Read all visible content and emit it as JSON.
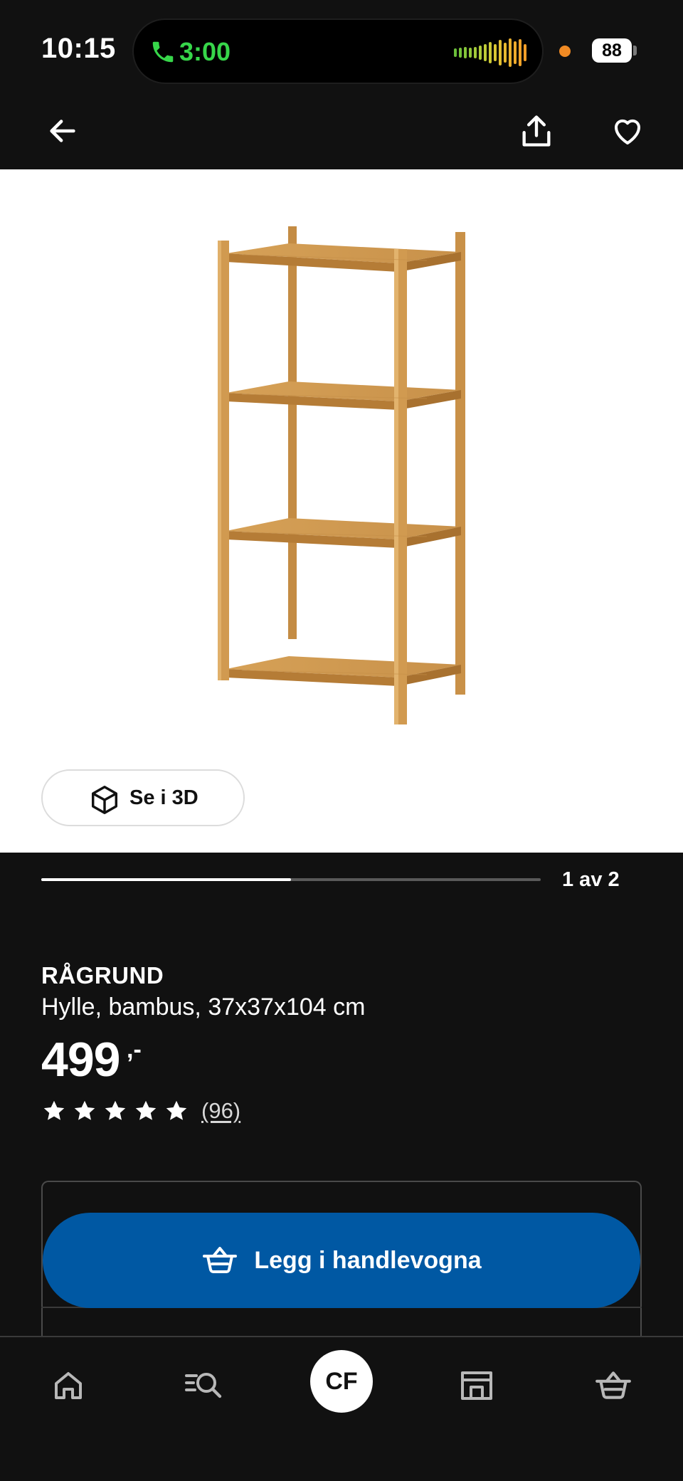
{
  "status_bar": {
    "time": "10:15",
    "call_duration": "3:00",
    "battery": "88"
  },
  "top_nav": {
    "back_icon": "arrow-left-icon",
    "share_icon": "share-icon",
    "favourite_icon": "heart-icon"
  },
  "gallery": {
    "view_3d_label": "Se i 3D",
    "page_counter": "1 av 2",
    "current_image": 1,
    "total_images": 2
  },
  "product": {
    "name": "RÅGRUND",
    "description": "Hylle, bambus, 37x37x104 cm",
    "price": "499",
    "price_suffix": ",-",
    "rating_stars": 5,
    "review_count": "(96)"
  },
  "actions": {
    "add_to_cart_label": "Legg i handlevogna"
  },
  "tab_bar": {
    "profile_initials": "CF",
    "tabs": [
      "home-icon",
      "search-icon",
      "profile-avatar",
      "store-icon",
      "cart-icon"
    ]
  },
  "colors": {
    "background": "#111111",
    "accent_blue": "#0058a3",
    "call_green": "#37d64a",
    "bamboo": "#d9a45a"
  }
}
